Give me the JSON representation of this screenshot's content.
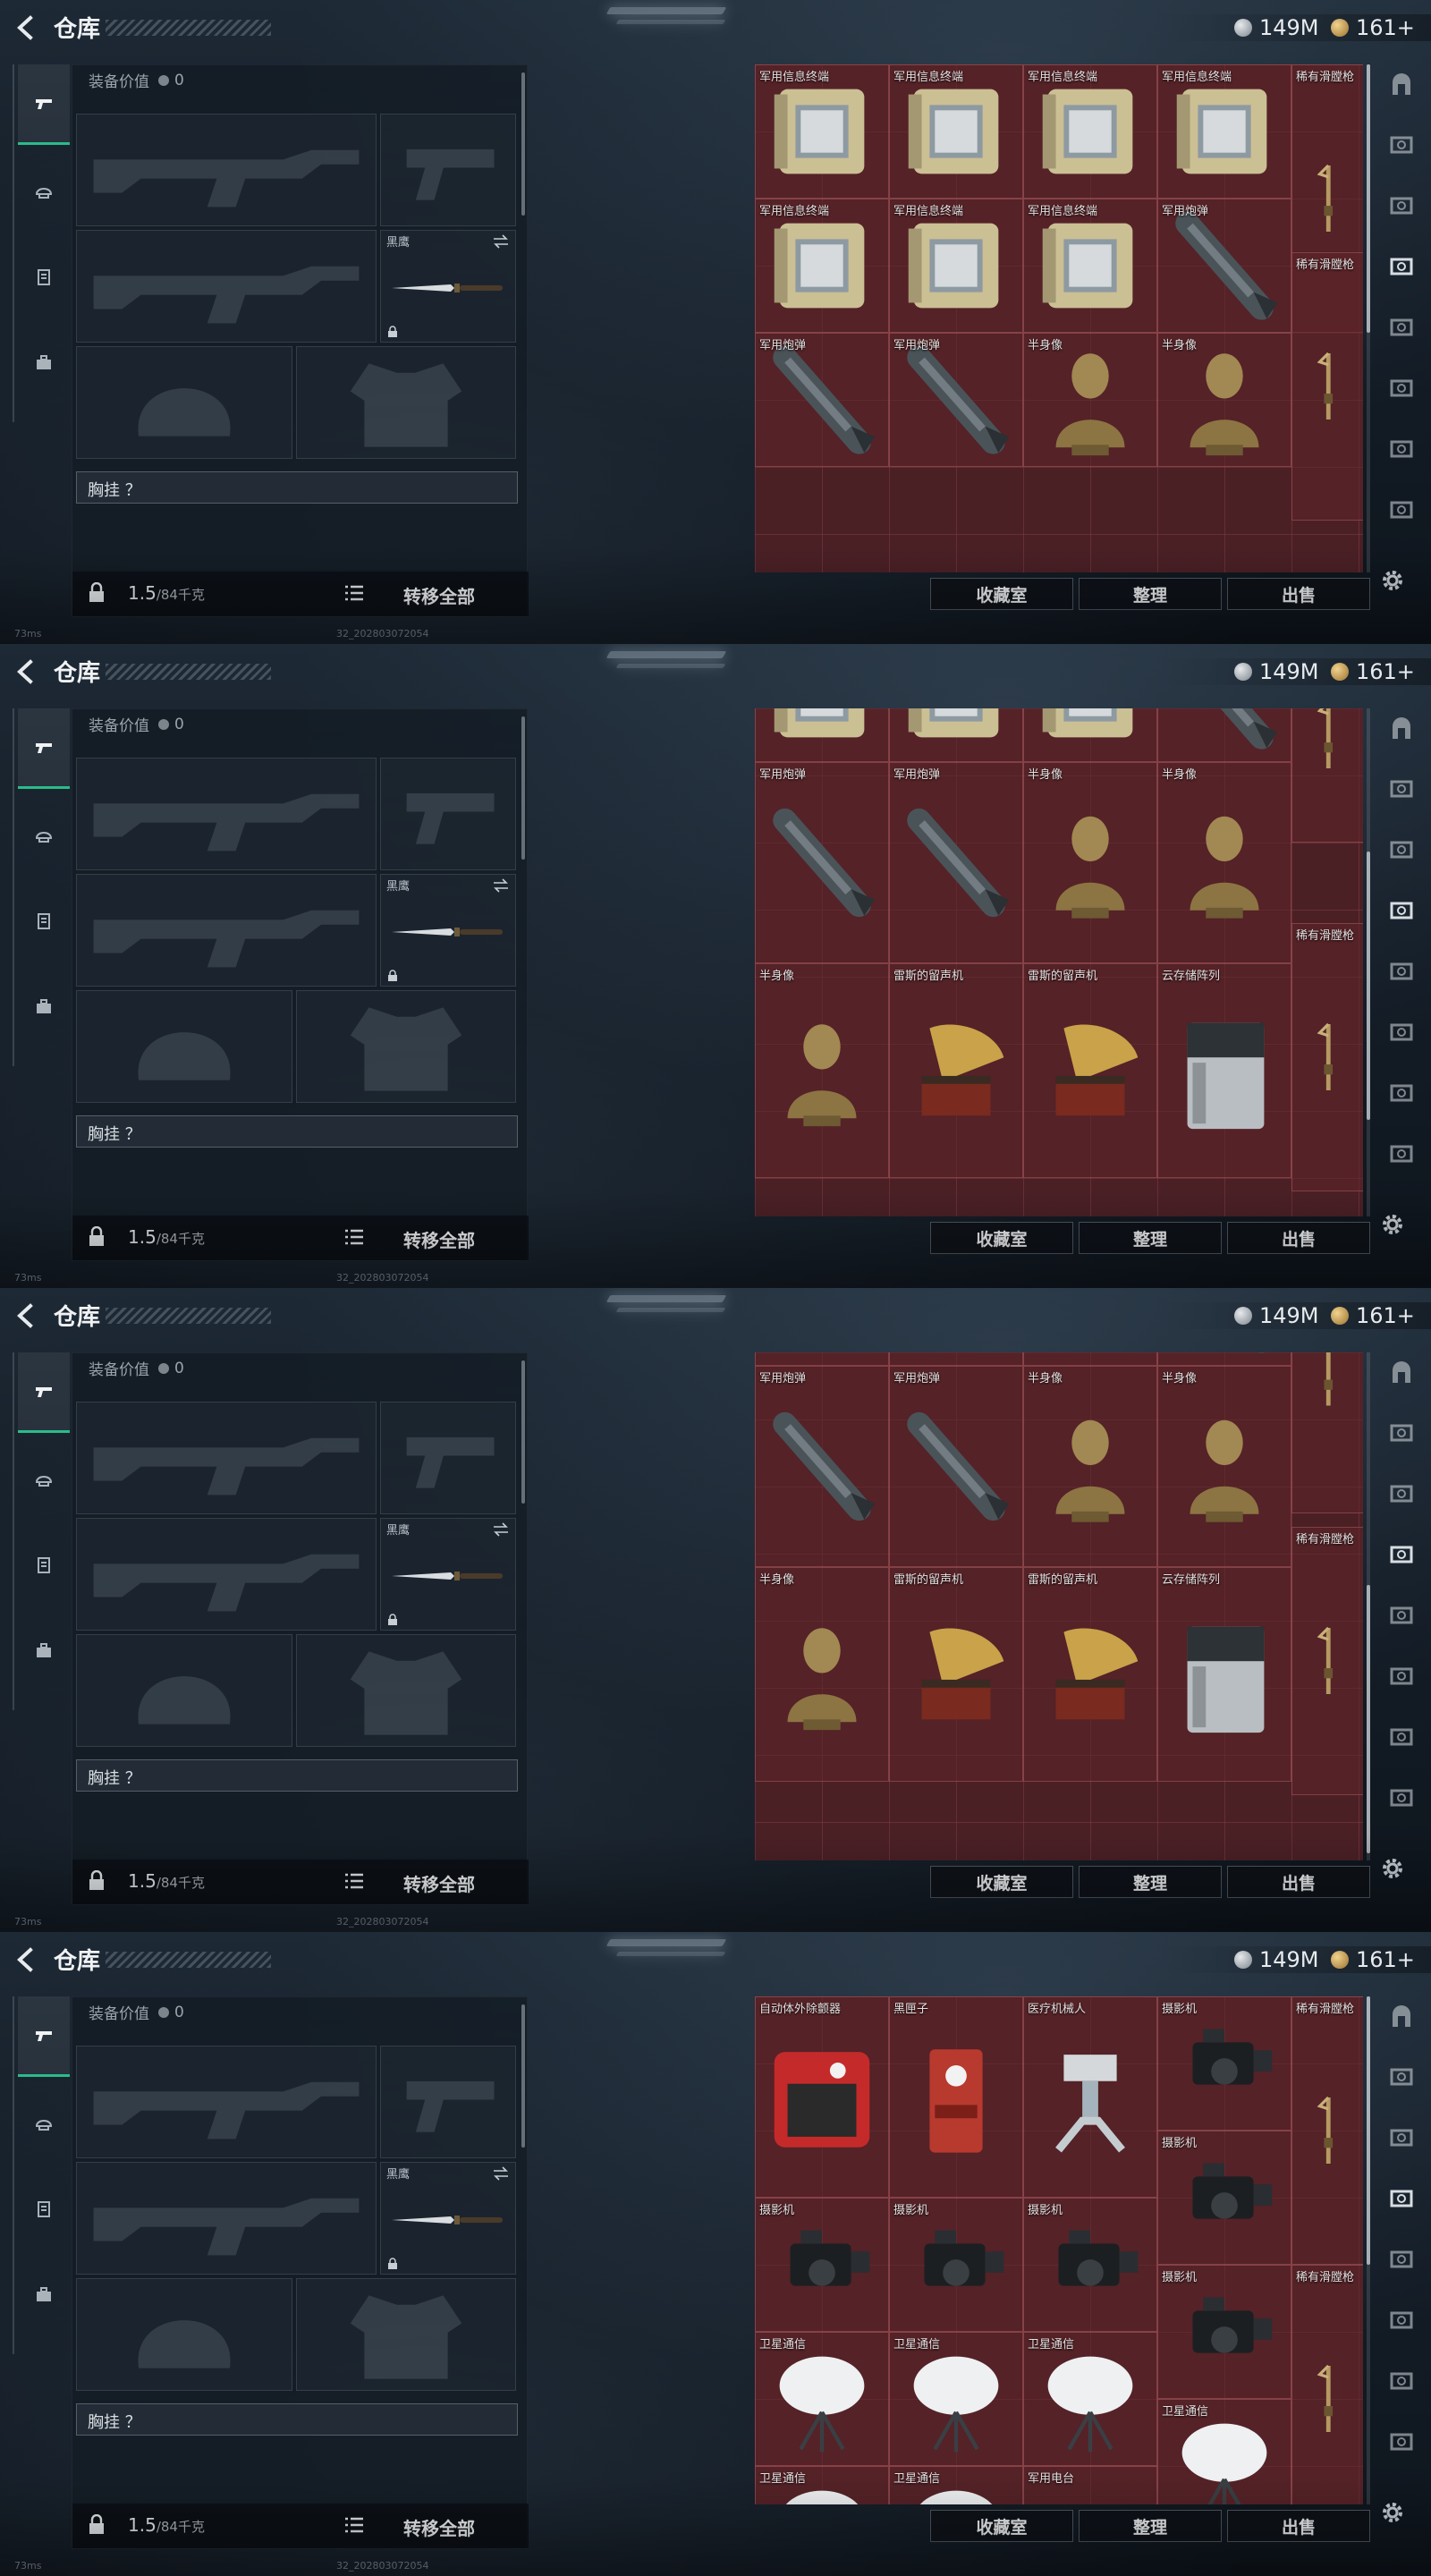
{
  "frames": [
    {
      "header": {
        "title": "仓库",
        "silver": "149M",
        "gold": "161+"
      },
      "equipment": {
        "value_label": "装备价值",
        "value": "0",
        "melee_label": "黑鹰",
        "chest_label": "胸挂 ？",
        "weight": "1.5",
        "capacity": "/84千克",
        "transfer_label": "转移全部"
      },
      "stash": {
        "buttons": {
          "collection": "收藏室",
          "organize": "整理",
          "sell": "出售"
        },
        "items": [
          {
            "label": "军用信息终端",
            "kind": "terminal",
            "col": 0,
            "row": 0,
            "w": 1,
            "h": 1
          },
          {
            "label": "军用信息终端",
            "kind": "terminal",
            "col": 1,
            "row": 0,
            "w": 1,
            "h": 1
          },
          {
            "label": "军用信息终端",
            "kind": "terminal",
            "col": 2,
            "row": 0,
            "w": 1,
            "h": 1
          },
          {
            "label": "军用信息终端",
            "kind": "terminal",
            "col": 3,
            "row": 0,
            "w": 1,
            "h": 1
          },
          {
            "label": "稀有滑膛枪",
            "kind": "musket",
            "col": 4,
            "row": 0,
            "w": 0.55,
            "h": 2
          },
          {
            "label": "军用信息终端",
            "kind": "terminal",
            "col": 0,
            "row": 1,
            "w": 1,
            "h": 1
          },
          {
            "label": "军用信息终端",
            "kind": "terminal",
            "col": 1,
            "row": 1,
            "w": 1,
            "h": 1
          },
          {
            "label": "军用信息终端",
            "kind": "terminal",
            "col": 2,
            "row": 1,
            "w": 1,
            "h": 1
          },
          {
            "label": "军用炮弹",
            "kind": "shell",
            "col": 3,
            "row": 1,
            "w": 1,
            "h": 1
          },
          {
            "label": "稀有滑膛枪",
            "kind": "musket",
            "col": 4,
            "row": 1.4,
            "w": 0.55,
            "h": 2
          },
          {
            "label": "军用炮弹",
            "kind": "shell",
            "col": 0,
            "row": 2,
            "w": 1,
            "h": 1
          },
          {
            "label": "军用炮弹",
            "kind": "shell",
            "col": 1,
            "row": 2,
            "w": 1,
            "h": 1
          },
          {
            "label": "半身像",
            "kind": "bust",
            "col": 2,
            "row": 2,
            "w": 1,
            "h": 1
          },
          {
            "label": "半身像",
            "kind": "bust",
            "col": 3,
            "row": 2,
            "w": 1,
            "h": 1
          }
        ],
        "scroll": 0
      }
    },
    {
      "header": {
        "title": "仓库",
        "silver": "149M",
        "gold": "161+"
      },
      "equipment": {
        "value_label": "装备价值",
        "value": "0",
        "melee_label": "黑鹰",
        "chest_label": "胸挂 ？",
        "weight": "1.5",
        "capacity": "/84千克",
        "transfer_label": "转移全部"
      },
      "stash": {
        "buttons": {
          "collection": "收藏室",
          "organize": "整理",
          "sell": "出售"
        },
        "items": [
          {
            "label": "",
            "kind": "terminal",
            "col": 0,
            "row": -0.6,
            "w": 1,
            "h": 1
          },
          {
            "label": "",
            "kind": "terminal",
            "col": 1,
            "row": -0.6,
            "w": 1,
            "h": 1
          },
          {
            "label": "",
            "kind": "terminal",
            "col": 2,
            "row": -0.6,
            "w": 1,
            "h": 1
          },
          {
            "label": "",
            "kind": "shell",
            "col": 3,
            "row": -0.6,
            "w": 1,
            "h": 1
          },
          {
            "label": "",
            "kind": "musket",
            "col": 4,
            "row": -0.6,
            "w": 0.55,
            "h": 1.6
          },
          {
            "label": "军用炮弹",
            "kind": "shell",
            "col": 0,
            "row": 0.4,
            "w": 1,
            "h": 1.5
          },
          {
            "label": "军用炮弹",
            "kind": "shell",
            "col": 1,
            "row": 0.4,
            "w": 1,
            "h": 1.5
          },
          {
            "label": "半身像",
            "kind": "bust",
            "col": 2,
            "row": 0.4,
            "w": 1,
            "h": 1.5
          },
          {
            "label": "半身像",
            "kind": "bust",
            "col": 3,
            "row": 0.4,
            "w": 1,
            "h": 1.5
          },
          {
            "label": "稀有滑膛枪",
            "kind": "musket",
            "col": 4,
            "row": 1.6,
            "w": 0.55,
            "h": 2
          },
          {
            "label": "半身像",
            "kind": "bust",
            "col": 0,
            "row": 1.9,
            "w": 1,
            "h": 1.6
          },
          {
            "label": "雷斯的留声机",
            "kind": "phonograph",
            "col": 1,
            "row": 1.9,
            "w": 1,
            "h": 1.6
          },
          {
            "label": "雷斯的留声机",
            "kind": "phonograph",
            "col": 2,
            "row": 1.9,
            "w": 1,
            "h": 1.6
          },
          {
            "label": "云存储阵列",
            "kind": "storage",
            "col": 3,
            "row": 1.9,
            "w": 1,
            "h": 1.6
          }
        ],
        "scroll": 1
      }
    },
    {
      "header": {
        "title": "仓库",
        "silver": "149M",
        "gold": "161+"
      },
      "equipment": {
        "value_label": "装备价值",
        "value": "0",
        "melee_label": "黑鹰",
        "chest_label": "胸挂 ？",
        "weight": "1.5",
        "capacity": "/84千克",
        "transfer_label": "转移全部"
      },
      "stash": {
        "buttons": {
          "collection": "收藏室",
          "organize": "整理",
          "sell": "出售"
        },
        "items": [
          {
            "label": "",
            "kind": "terminal",
            "col": 0,
            "row": -0.9,
            "w": 1,
            "h": 1
          },
          {
            "label": "",
            "kind": "terminal",
            "col": 1,
            "row": -0.9,
            "w": 1,
            "h": 1
          },
          {
            "label": "",
            "kind": "terminal",
            "col": 2,
            "row": -0.9,
            "w": 1,
            "h": 1
          },
          {
            "label": "",
            "kind": "shell",
            "col": 3,
            "row": -0.9,
            "w": 1,
            "h": 1
          },
          {
            "label": "",
            "kind": "musket",
            "col": 4,
            "row": -0.9,
            "w": 0.55,
            "h": 2.1
          },
          {
            "label": "军用炮弹",
            "kind": "shell",
            "col": 0,
            "row": 0.1,
            "w": 1,
            "h": 1.5
          },
          {
            "label": "军用炮弹",
            "kind": "shell",
            "col": 1,
            "row": 0.1,
            "w": 1,
            "h": 1.5
          },
          {
            "label": "半身像",
            "kind": "bust",
            "col": 2,
            "row": 0.1,
            "w": 1,
            "h": 1.5
          },
          {
            "label": "半身像",
            "kind": "bust",
            "col": 3,
            "row": 0.1,
            "w": 1,
            "h": 1.5
          },
          {
            "label": "稀有滑膛枪",
            "kind": "musket",
            "col": 4,
            "row": 1.3,
            "w": 0.55,
            "h": 2
          },
          {
            "label": "半身像",
            "kind": "bust",
            "col": 0,
            "row": 1.6,
            "w": 1,
            "h": 1.6
          },
          {
            "label": "雷斯的留声机",
            "kind": "phonograph",
            "col": 1,
            "row": 1.6,
            "w": 1,
            "h": 1.6
          },
          {
            "label": "雷斯的留声机",
            "kind": "phonograph",
            "col": 2,
            "row": 1.6,
            "w": 1,
            "h": 1.6
          },
          {
            "label": "云存储阵列",
            "kind": "storage",
            "col": 3,
            "row": 1.6,
            "w": 1,
            "h": 1.6
          }
        ],
        "scroll": 2
      }
    },
    {
      "header": {
        "title": "仓库",
        "silver": "149M",
        "gold": "161+"
      },
      "equipment": {
        "value_label": "装备价值",
        "value": "0",
        "melee_label": "黑鹰",
        "chest_label": "胸挂 ？",
        "weight": "1.5",
        "capacity": "/84千克",
        "transfer_label": "转移全部"
      },
      "stash": {
        "buttons": {
          "collection": "收藏室",
          "organize": "整理",
          "sell": "出售"
        },
        "items": [
          {
            "label": "自动体外除颤器",
            "kind": "aed",
            "col": 0,
            "row": 0,
            "w": 1,
            "h": 1.5
          },
          {
            "label": "黑匣子",
            "kind": "blackbox",
            "col": 1,
            "row": 0,
            "w": 1,
            "h": 1.5
          },
          {
            "label": "医疗机械人",
            "kind": "robot",
            "col": 2,
            "row": 0,
            "w": 1,
            "h": 1.5
          },
          {
            "label": "摄影机",
            "kind": "camera",
            "col": 3,
            "row": 0,
            "w": 1,
            "h": 1
          },
          {
            "label": "稀有滑膛枪",
            "kind": "musket",
            "col": 4,
            "row": 0,
            "w": 0.55,
            "h": 2
          },
          {
            "label": "摄影机",
            "kind": "camera",
            "col": 3,
            "row": 1,
            "w": 1,
            "h": 1
          },
          {
            "label": "摄影机",
            "kind": "camera",
            "col": 0,
            "row": 1.5,
            "w": 1,
            "h": 1
          },
          {
            "label": "摄影机",
            "kind": "camera",
            "col": 1,
            "row": 1.5,
            "w": 1,
            "h": 1
          },
          {
            "label": "摄影机",
            "kind": "camera",
            "col": 2,
            "row": 1.5,
            "w": 1,
            "h": 1
          },
          {
            "label": "摄影机",
            "kind": "camera",
            "col": 3,
            "row": 2,
            "w": 1,
            "h": 1
          },
          {
            "label": "稀有滑膛枪",
            "kind": "musket",
            "col": 4,
            "row": 2,
            "w": 0.55,
            "h": 2
          },
          {
            "label": "卫星通信",
            "kind": "dish",
            "col": 0,
            "row": 2.5,
            "w": 1,
            "h": 1
          },
          {
            "label": "卫星通信",
            "kind": "dish",
            "col": 1,
            "row": 2.5,
            "w": 1,
            "h": 1
          },
          {
            "label": "卫星通信",
            "kind": "dish",
            "col": 2,
            "row": 2.5,
            "w": 1,
            "h": 1
          },
          {
            "label": "卫星通信",
            "kind": "dish",
            "col": 3,
            "row": 3,
            "w": 1,
            "h": 1
          },
          {
            "label": "卫星通信",
            "kind": "dish",
            "col": 0,
            "row": 3.5,
            "w": 1,
            "h": 1
          },
          {
            "label": "卫星通信",
            "kind": "dish",
            "col": 1,
            "row": 3.5,
            "w": 1,
            "h": 1
          },
          {
            "label": "军用电台",
            "kind": "radio",
            "col": 2,
            "row": 3.5,
            "w": 1,
            "h": 1
          }
        ],
        "scroll": 0
      }
    }
  ],
  "status": {
    "ping": "73ms",
    "build": "32_202803072054"
  },
  "icons": {
    "back": "back-arrow-icon",
    "silver": "silver-coin-icon",
    "gold": "gold-coin-icon",
    "nav": [
      "pistol-icon",
      "helmet-icon",
      "clipboard-icon",
      "briefcase-icon"
    ],
    "rail": [
      "arch-icon",
      "stash-tab-icon",
      "stash-tab-icon",
      "stash-tab-icon",
      "stash-tab-icon",
      "stash-tab-icon",
      "stash-tab-icon",
      "stash-tab-icon"
    ],
    "settings": "gear-icon"
  },
  "colors": {
    "accent": "#2bbb8a",
    "stash_bg": "#4a2025",
    "panel": "#141c24"
  }
}
